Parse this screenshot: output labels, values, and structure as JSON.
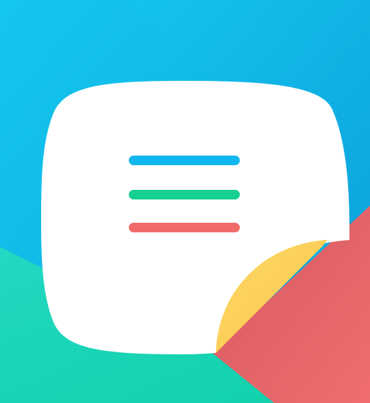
{
  "app_icon": {
    "icon_name": "notes-app-icon",
    "background": {
      "top_color": "#0fb2e6",
      "top_left_color": "#14c7ee",
      "bottom_left_color": "#1fd6b8",
      "bottom_right_color": "#e86a6a"
    },
    "note_sheet_color": "#ffffff",
    "page_curl_color": "#ffd15a",
    "lines": [
      {
        "name": "blue-line",
        "color": "#12b7f0"
      },
      {
        "name": "green-line",
        "color": "#15d08f"
      },
      {
        "name": "red-line",
        "color": "#f06a6a"
      }
    ]
  }
}
